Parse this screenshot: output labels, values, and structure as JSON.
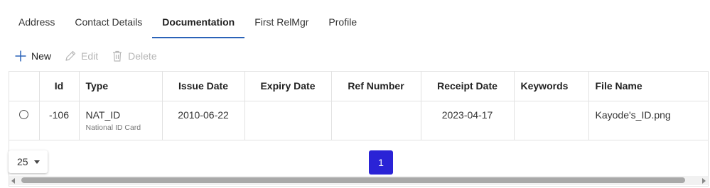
{
  "tabs": [
    {
      "label": "Address",
      "active": false
    },
    {
      "label": "Contact Details",
      "active": false
    },
    {
      "label": "Documentation",
      "active": true
    },
    {
      "label": "First RelMgr",
      "active": false
    },
    {
      "label": "Profile",
      "active": false
    }
  ],
  "toolbar": {
    "new_label": "New",
    "edit_label": "Edit",
    "delete_label": "Delete",
    "icons": {
      "new": "plus-icon",
      "edit": "pencil-icon",
      "delete": "trash-icon"
    }
  },
  "grid": {
    "columns": [
      "Id",
      "Type",
      "Issue Date",
      "Expiry Date",
      "Ref Number",
      "Receipt Date",
      "Keywords",
      "File Name"
    ],
    "rows": [
      {
        "id": "-106",
        "type": "NAT_ID",
        "type_desc": "National ID Card",
        "issue_date": "2010-06-22",
        "expiry_date": "",
        "ref_number": "",
        "receipt_date": "2023-04-17",
        "keywords": "",
        "file_name": "Kayode's_ID.png"
      }
    ]
  },
  "pager": {
    "page_size": "25",
    "current_page": "1"
  },
  "colors": {
    "active_tab_underline": "#2b63b8",
    "page_button": "#2a23d6",
    "disabled_text": "#b6b6b6"
  }
}
